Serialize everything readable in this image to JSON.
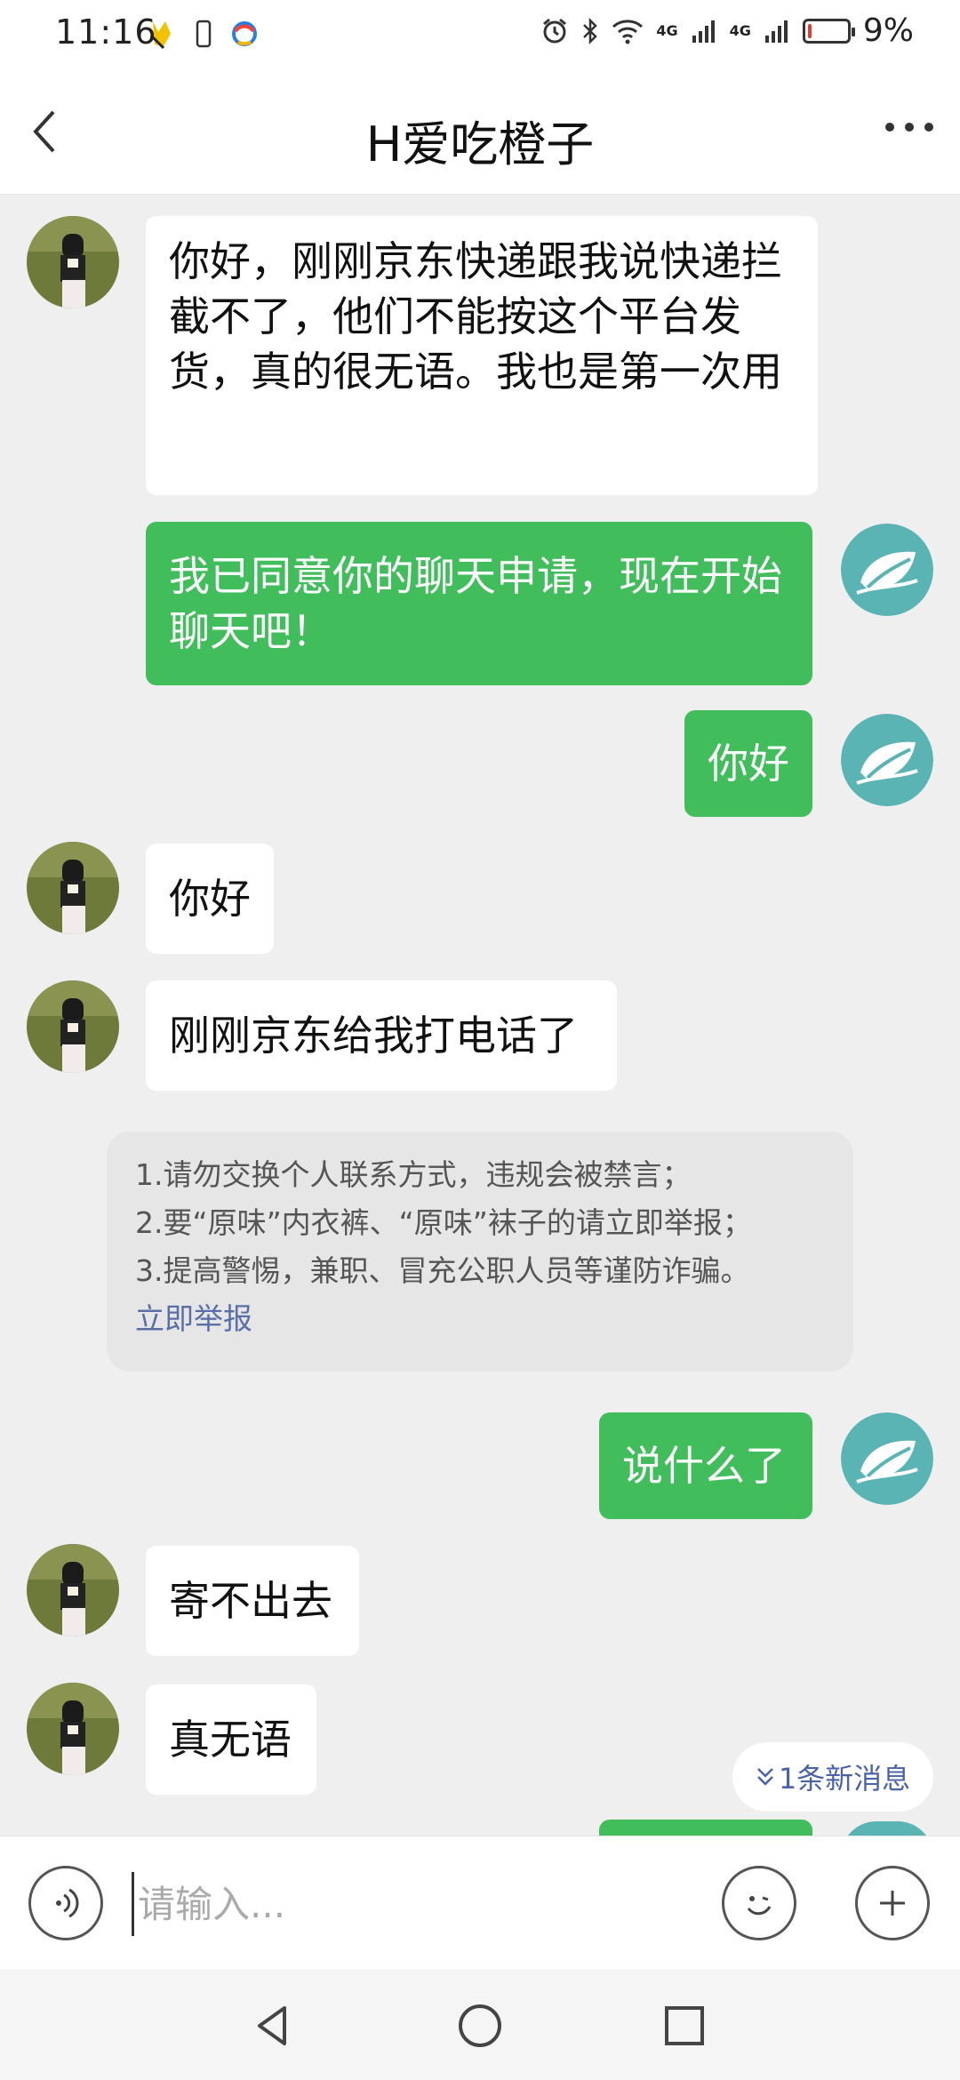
{
  "status_bar": {
    "time": "11:16",
    "network_label_1": "4G",
    "network_label_2": "4G",
    "battery_percent": 9,
    "battery_text": "9%"
  },
  "header": {
    "title": "H爱吃橙子"
  },
  "messages": [
    {
      "side": "in",
      "text": "你好，刚刚京东快递跟我说快递拦截不了，他们不能按这个平台发货，真的很无语。我也是第一次用"
    },
    {
      "side": "out",
      "text": "我已同意你的聊天申请，现在开始聊天吧！"
    },
    {
      "side": "out",
      "text": "你好"
    },
    {
      "side": "in",
      "text": "你好"
    },
    {
      "side": "in",
      "text": "刚刚京东给我打电话了"
    },
    {
      "side": "out",
      "text": "说什么了"
    },
    {
      "side": "in",
      "text": "寄不出去"
    },
    {
      "side": "in",
      "text": "真无语"
    }
  ],
  "notice": {
    "line1": "1.请勿交换个人联系方式，违规会被禁言；",
    "line2": "2.要“原味”内衣裤、“原味”袜子的请立即举报；",
    "line3": "3.提高警惕，兼职、冒充公职人员等谨防诈骗。",
    "report_link": "立即举报"
  },
  "new_message_hint": "1条新消息",
  "input": {
    "placeholder": "请输入..."
  },
  "colors": {
    "outgoing_bubble": "#42bd5c",
    "incoming_bubble": "#ffffff",
    "background": "#efefef",
    "link": "#5a6fa6",
    "battery_low": "#e53935"
  },
  "icons": [
    "back-arrow-icon",
    "more-icon",
    "voice-icon",
    "emoji-icon",
    "plus-icon",
    "chevron-down-icon",
    "nav-back-icon",
    "nav-home-icon",
    "nav-recent-icon"
  ]
}
